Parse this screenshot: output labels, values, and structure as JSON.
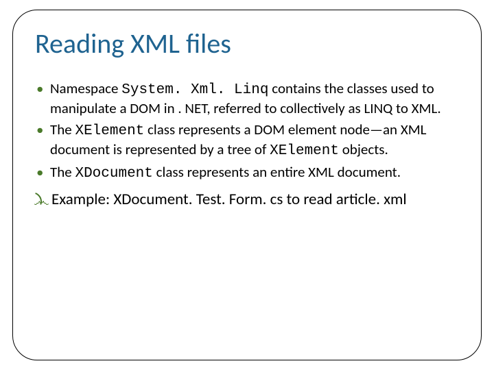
{
  "title": "Reading XML files",
  "bullets": [
    {
      "pre": "Namespace ",
      "code": "System. Xml. Linq",
      "post": " contains the classes used to manipulate a DOM in . NET, referred to collectively as LINQ to XML."
    },
    {
      "pre": "The ",
      "code": "XElement",
      "post": " class represents a DOM element node—an XML document is represented by a tree of ",
      "code2": "XElement",
      "post2": " objects."
    },
    {
      "pre": "The ",
      "code": "XDocument",
      "post": " class represents an entire XML document."
    }
  ],
  "example": {
    "label": "Example: ",
    "filename": "XDocument. Test. Form. cs",
    "rest": " to read article. xml"
  }
}
